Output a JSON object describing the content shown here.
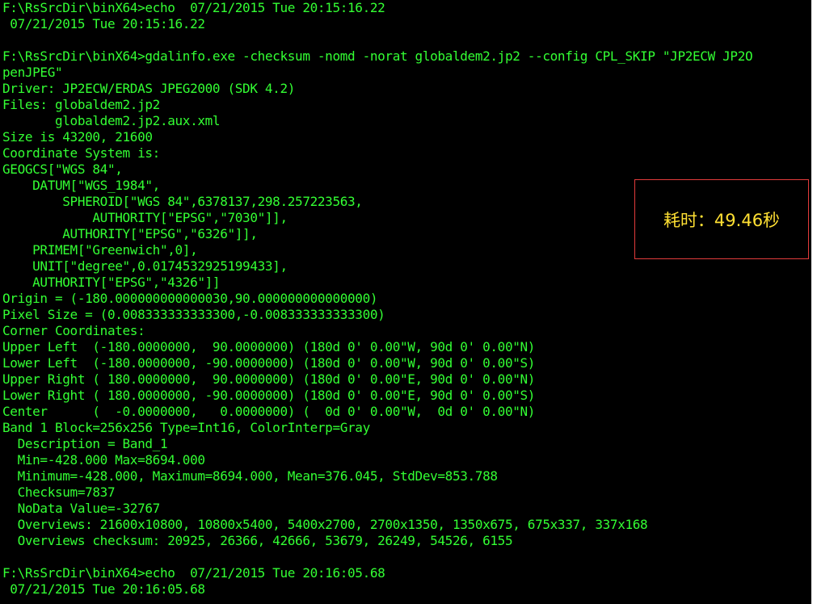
{
  "terminal": {
    "lines": [
      "F:\\RsSrcDir\\binX64>echo  07/21/2015 Tue 20:15:16.22",
      " 07/21/2015 Tue 20:15:16.22",
      "",
      "F:\\RsSrcDir\\binX64>gdalinfo.exe -checksum -nomd -norat globaldem2.jp2 --config CPL_SKIP \"JP2ECW JP2O",
      "penJPEG\"",
      "Driver: JP2ECW/ERDAS JPEG2000 (SDK 4.2)",
      "Files: globaldem2.jp2",
      "       globaldem2.jp2.aux.xml",
      "Size is 43200, 21600",
      "Coordinate System is:",
      "GEOGCS[\"WGS 84\",",
      "    DATUM[\"WGS_1984\",",
      "        SPHEROID[\"WGS 84\",6378137,298.257223563,",
      "            AUTHORITY[\"EPSG\",\"7030\"]],",
      "        AUTHORITY[\"EPSG\",\"6326\"]],",
      "    PRIMEM[\"Greenwich\",0],",
      "    UNIT[\"degree\",0.0174532925199433],",
      "    AUTHORITY[\"EPSG\",\"4326\"]]",
      "Origin = (-180.000000000000030,90.000000000000000)",
      "Pixel Size = (0.008333333333300,-0.008333333333300)",
      "Corner Coordinates:",
      "Upper Left  (-180.0000000,  90.0000000) (180d 0' 0.00\"W, 90d 0' 0.00\"N)",
      "Lower Left  (-180.0000000, -90.0000000) (180d 0' 0.00\"W, 90d 0' 0.00\"S)",
      "Upper Right ( 180.0000000,  90.0000000) (180d 0' 0.00\"E, 90d 0' 0.00\"N)",
      "Lower Right ( 180.0000000, -90.0000000) (180d 0' 0.00\"E, 90d 0' 0.00\"S)",
      "Center      (  -0.0000000,   0.0000000) (  0d 0' 0.00\"W,  0d 0' 0.00\"N)",
      "Band 1 Block=256x256 Type=Int16, ColorInterp=Gray",
      "  Description = Band_1",
      "  Min=-428.000 Max=8694.000",
      "  Minimum=-428.000, Maximum=8694.000, Mean=376.045, StdDev=853.788",
      "  Checksum=7837",
      "  NoData Value=-32767",
      "  Overviews: 21600x10800, 10800x5400, 5400x2700, 2700x1350, 1350x675, 675x337, 337x168",
      "  Overviews checksum: 20925, 26366, 42666, 53679, 26249, 54526, 6155",
      "",
      "F:\\RsSrcDir\\binX64>echo  07/21/2015 Tue 20:16:05.68",
      " 07/21/2015 Tue 20:16:05.68"
    ]
  },
  "annotation": {
    "timing_label": "耗时：49.46秒"
  },
  "colors": {
    "terminal_background": "#000000",
    "terminal_text": "#33ff33",
    "annotation_text": "#ffe033",
    "annotation_border": "#e33b3b"
  }
}
